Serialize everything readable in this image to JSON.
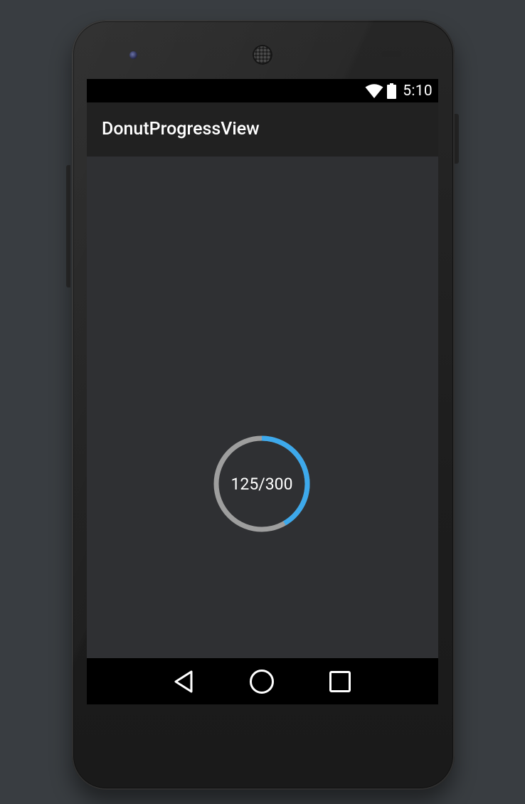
{
  "status_bar": {
    "time": "5:10",
    "icons": [
      "wifi-icon",
      "battery-icon"
    ]
  },
  "app_bar": {
    "title": "DonutProgressView"
  },
  "donut_progress": {
    "label": "125/300",
    "current": 125,
    "max": 300,
    "progress_color": "#3da9ec",
    "track_color": "#9e9e9e"
  },
  "nav_bar": {
    "icons": [
      "back-icon",
      "home-icon",
      "recent-apps-icon"
    ]
  },
  "colors": {
    "background": "#393d41",
    "screen_background": "#2f3033",
    "app_bar": "#212121",
    "system_bars": "#000000"
  }
}
